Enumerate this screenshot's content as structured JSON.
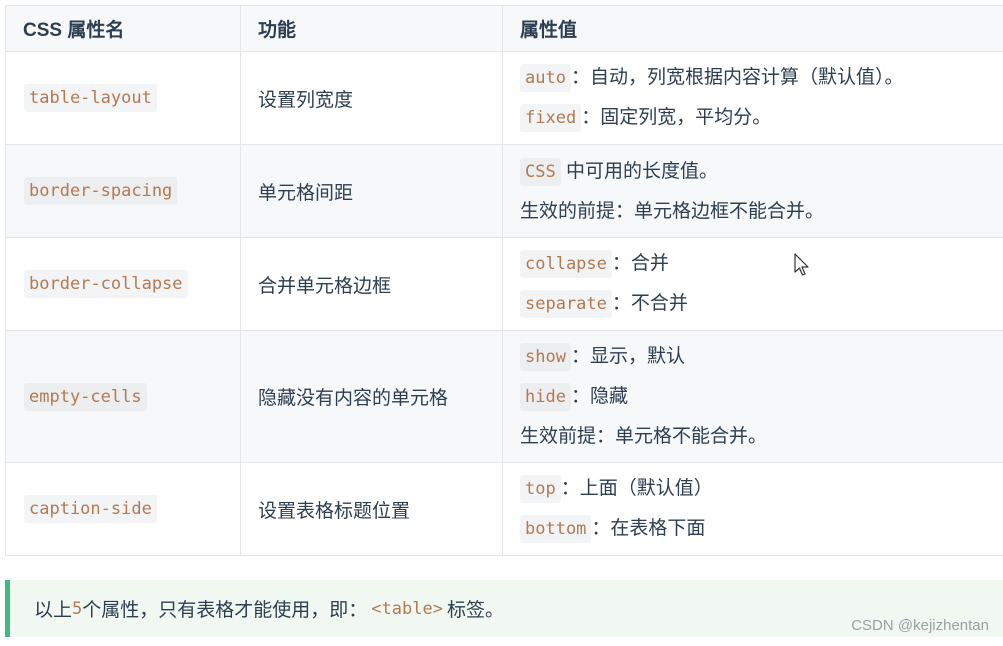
{
  "table": {
    "headers": [
      "CSS 属性名",
      "功能",
      "属性值"
    ],
    "rows": [
      {
        "property": "table-layout",
        "function": "设置列宽度",
        "values": [
          {
            "code": "auto",
            "text": "：自动，列宽根据内容计算（默认值）。"
          },
          {
            "code": "fixed",
            "text": "：固定列宽，平均分。"
          }
        ]
      },
      {
        "property": "border-spacing",
        "function": "单元格间距",
        "values": [
          {
            "code": "CSS",
            "text": " 中可用的长度值。"
          },
          {
            "code": "",
            "text": "生效的前提：单元格边框不能合并。"
          }
        ]
      },
      {
        "property": "border-collapse",
        "function": "合并单元格边框",
        "values": [
          {
            "code": "collapse",
            "text": "：合并"
          },
          {
            "code": "separate",
            "text": "：不合并"
          }
        ]
      },
      {
        "property": "empty-cells",
        "function": "隐藏没有内容的单元格",
        "values": [
          {
            "code": "show",
            "text": "：显示，默认"
          },
          {
            "code": "hide",
            "text": "：隐藏"
          },
          {
            "code": "",
            "text": "生效前提：单元格不能合并。"
          }
        ]
      },
      {
        "property": "caption-side",
        "function": "设置表格标题位置",
        "values": [
          {
            "code": "top",
            "text": "：上面（默认值）"
          },
          {
            "code": "bottom",
            "text": "：在表格下面"
          }
        ]
      }
    ]
  },
  "tip": {
    "prefix": "以上 ",
    "count": "5",
    "middle": " 个属性，只有表格才能使用，即：",
    "code": "<table>",
    "suffix": "标签。"
  },
  "watermark": "CSDN @kejizhentan",
  "colors": {
    "accent": "#42b983",
    "code_text": "#b5794f"
  },
  "icons": [
    "mouse-cursor-icon"
  ]
}
